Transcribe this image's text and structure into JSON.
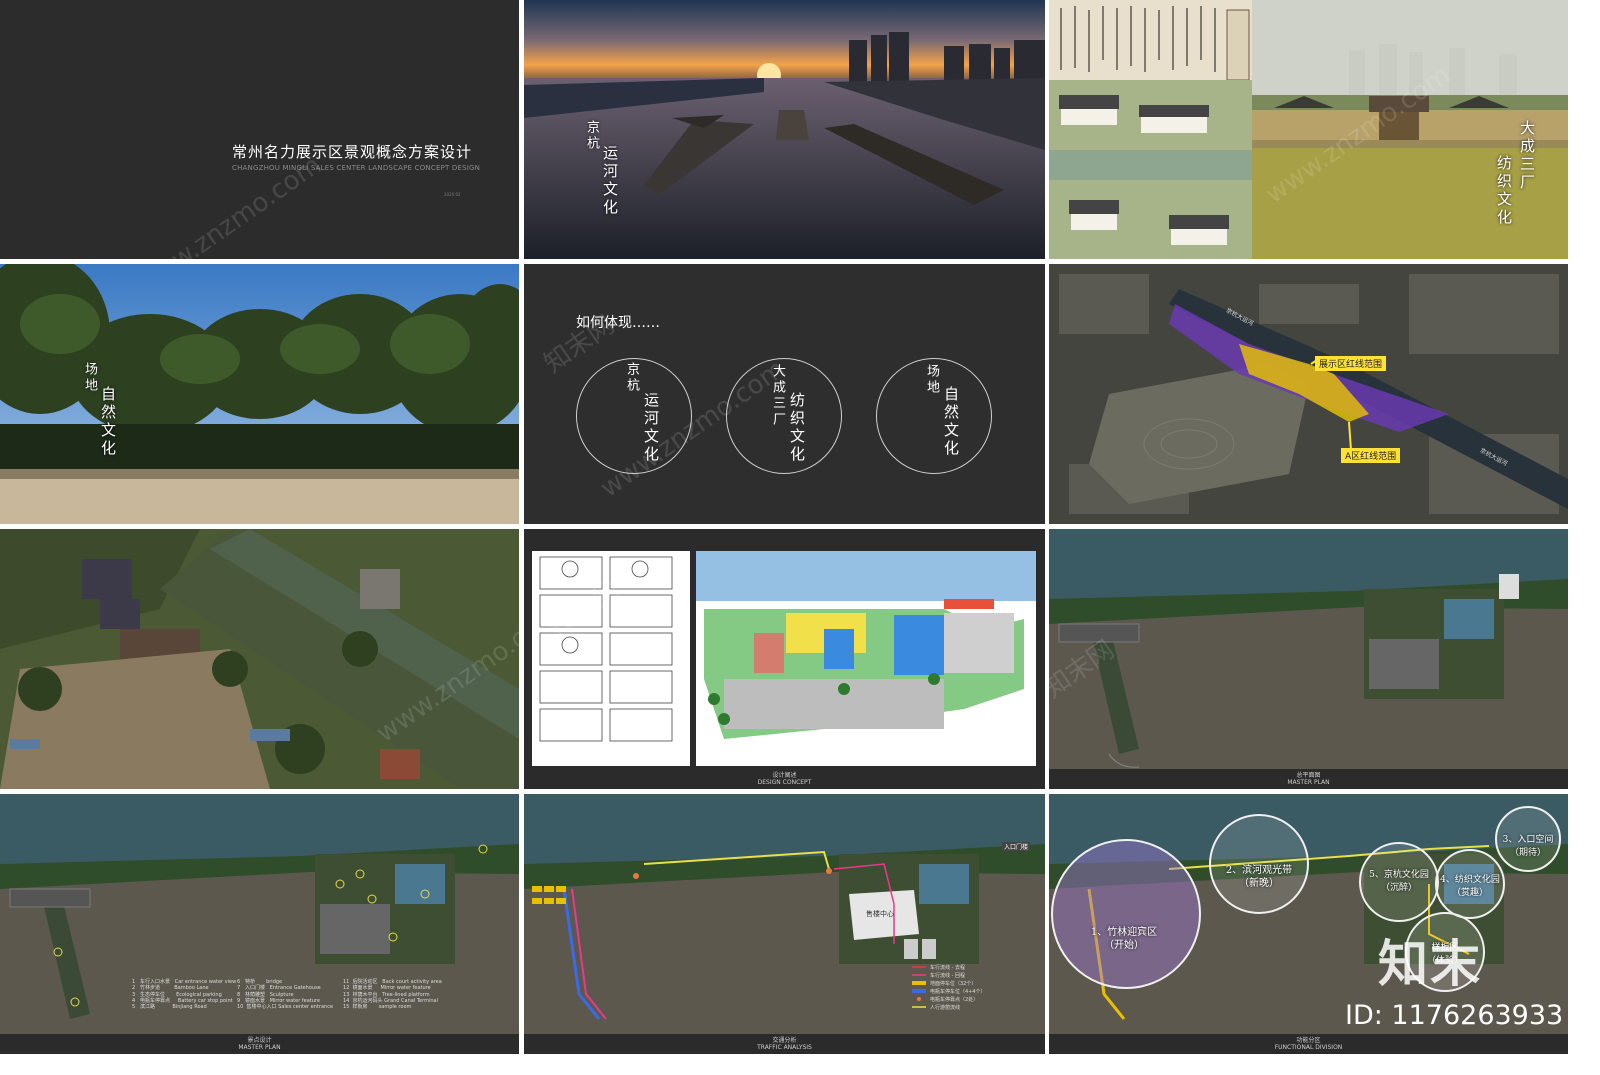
{
  "cover": {
    "title_cn": "常州名力展示区景观概念方案设计",
    "title_en": "CHANGZHOU MINGLI SALES CENTER LANDSCAPE CONCEPT DESIGN",
    "date": "2020.02"
  },
  "canal_photo": {
    "label_a": "京杭",
    "label_b": "运河文化"
  },
  "textile_photo": {
    "label_a": "大成三厂",
    "label_b": "纺织文化"
  },
  "trees_photo": {
    "label_a": "场地",
    "label_b": "自然文化"
  },
  "concept": {
    "heading": "如何体现……",
    "circles": [
      {
        "a": "京杭",
        "b": "运河文化"
      },
      {
        "a": "大成三厂",
        "b": "纺织文化"
      },
      {
        "a": "场地",
        "b": "自然文化"
      }
    ]
  },
  "site_map": {
    "label_display": "展示区红线范围",
    "label_a": "A区红线范围",
    "road_labels": [
      "京杭大运河",
      "京杭大运河"
    ]
  },
  "sketch": {
    "caption_cn": "设计阐述",
    "caption_en": "DESIGN CONCEPT"
  },
  "master_plan": {
    "caption_cn": "总平面图",
    "caption_en": "MASTER PLAN"
  },
  "master_plan_legend": {
    "caption_cn": "景点设计",
    "caption_en": "MASTER PLAN",
    "col1": "1   车行入口水景   Car entrance water view\n2   竹林步道         Bamboo Lane\n3   生态停车位       Ecological parking\n4   电瓶车停靠点     Battery car stop point\n5   滨江路           Binjiang Road",
    "col2": "6   特桥       bridge\n7   入口门楼   Entrance Gatehouse\n8   林荫雕塑   Sculpture\n9   镜面水景   Mirror water feature\n10  售楼中心入口 Sales center entrance",
    "col3": "11  后院活动区   Back court activity area\n12  镜面水景     Mirror water feature\n13  林荫木平台   Tree-lined platform\n14  京杭运河码头 Grand Canal Terminal\n15  样板房       sample room"
  },
  "traffic": {
    "caption_cn": "交通分析",
    "caption_en": "TRAFFIC ANALYSIS",
    "center_label": "售楼中心",
    "gate_label": "入口门楼",
    "legend": "车行流线 - 去程\n车行流线 - 回程\n地面停车位（32个）\n电瓶车停车位（4+4个）\n电瓶车停靠点（2处）\n人行游憩流线"
  },
  "functional": {
    "caption_cn": "功能分区",
    "caption_en": "FUNCTIONAL DIVISION",
    "zones": [
      "1、竹林迎宾区\n（开始）",
      "2、滨河观光带\n（新晚）",
      "3、入口空间\n（期待）",
      "4、纺织文化园\n（赏趣）",
      "5、京杭文化园\n（沉醉）",
      "样板区\n（体验）"
    ]
  },
  "watermarks": {
    "site": "www.znzmo.com",
    "brand": "知末",
    "brand_net": "知末网",
    "id_text": "ID: 1176263933"
  },
  "colors": {
    "panel_bg": "#2b2b2b",
    "purple_zone": "#5a2ea0",
    "yellow_zone": "#e8c400",
    "label_yellow": "#ffe233"
  }
}
